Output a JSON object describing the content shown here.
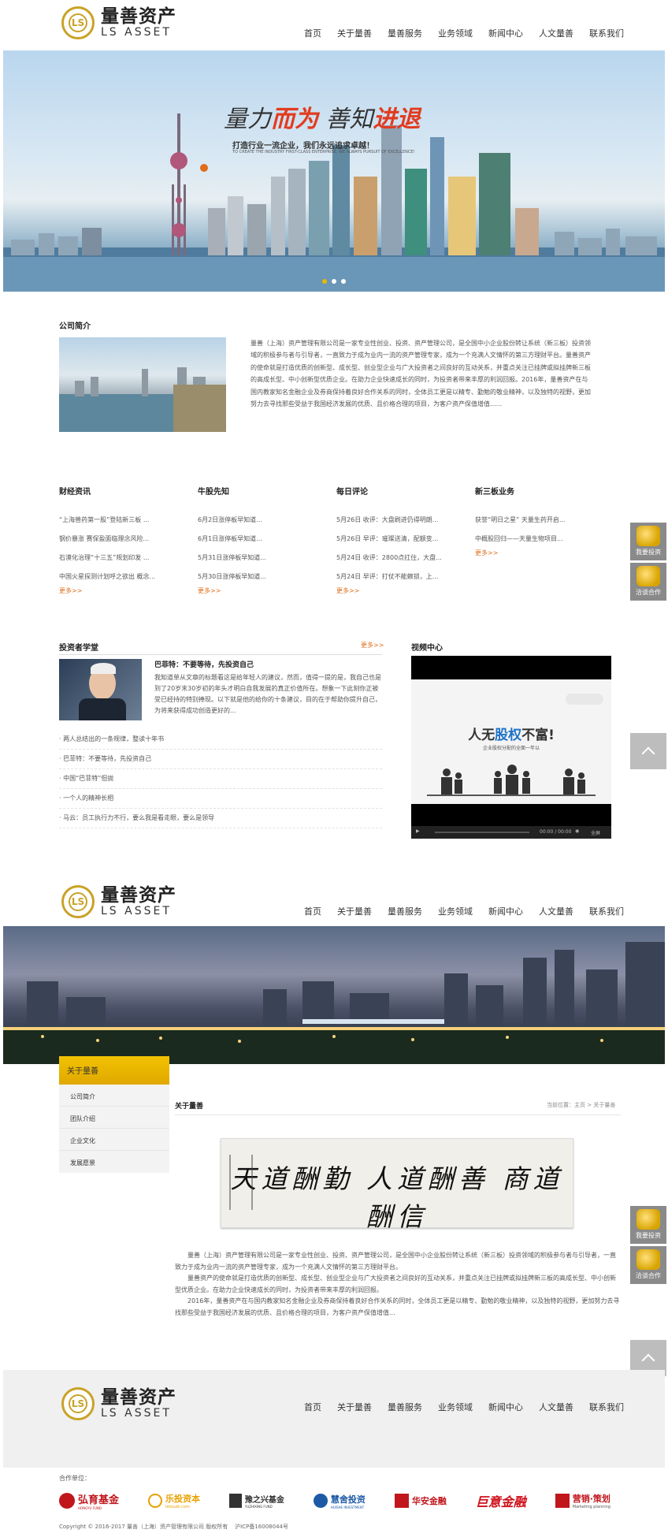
{
  "brand": {
    "name_cn": "量善资产",
    "name_en": "LS ASSET",
    "mark": "LS"
  },
  "nav": [
    "首页",
    "关于量善",
    "量善服务",
    "业务领域",
    "新闻中心",
    "人文量善",
    "联系我们"
  ],
  "banner1": {
    "slogan_part1": "量力",
    "slogan_part2": "而为",
    "slogan_part3": " 善知",
    "slogan_part4": "进退",
    "subtitle_cn": "打造行业一流企业，我们永远追求卓越！",
    "subtitle_en": "TO CREATE THE INDUSTRY FIRST-CLASS ENTERPRISE, WE ALWAYS PURSUIT OF EXCELLENCE!"
  },
  "intro": {
    "title": "公司简介",
    "text": "量善（上海）资产管理有限公司是一家专业性创业、投资、资产管理公司，是全国中小企业股份转让系统（新三板）投资领域的积极参与者与引导者，一直致力于成为业内一流的资产管理专家，成为一个充满人文情怀的第三方理财平台。量善资产的使命就是打造优质的创新型、成长型、创业型企业与广大投资者之间良好的互动关系，并重点关注已挂牌或拟挂牌新三板的高成长型、中小创新型优质企业。在助力企业快速成长的同时，为投资者带来丰厚的利润回报。2016年，量善资产在与国内教家知名金融企业及券商保持着良好合作关系的同时，全体员工更是以精专、勤勉的敬业精神，以及独特的视野，更加努力去寻找那些受益于我国经济发展的优质、且价格合理的项目，为客户资产保值增值......"
  },
  "news_columns": [
    {
      "title": "财经资讯",
      "items": [
        "“上海兽药第一股”登陆新三板 ...",
        "钢价暴涨 赛保盈面临理念风险...",
        "石漠化治理“十三五”规划印发 ...",
        "中国火星探测计划呼之欲出 概念..."
      ],
      "more": "更多>>"
    },
    {
      "title": "牛股先知",
      "items": [
        "6月2日涨停板早知道...",
        "6月1日涨停板早知道...",
        "5月31日涨停板早知道...",
        "5月30日涨停板早知道..."
      ],
      "more": "更多>>"
    },
    {
      "title": "每日评论",
      "items": [
        "5月26日 收评：大盘刷进仍得明朗...",
        "5月26日 早评：璀璨送清，配额变...",
        "5月24日 收评：2800点扛住，大盘...",
        "5月24日 早评：打仗不能赖锁，上..."
      ],
      "more": "更多>>"
    },
    {
      "title": "新三板业务",
      "items": [
        "获誉“明日之星” 天量生药开启...",
        "中概股回归——天量生物项目...",
        "",
        ""
      ],
      "more": "更多>>"
    }
  ],
  "school": {
    "title": "投资者学堂",
    "more": "更多>>",
    "feature_title": "巴菲特：不要等待，先投资自己",
    "feature_text": "我知道单从文章的标题看这是给年轻人的建议，然而，值得一提的是，我自己也是到了20岁末30岁初的年头才明白自我发展的真正价值所在。想象一下此刻你正被受已经持的特别捧现。以下就是他的给你的十条建议，目的在于帮助你提升自己，为将来获得成功创造更好的...",
    "items": [
      "两人总结出的一条规律，整读十年书",
      "巴菲特：不要等待，先投资自己",
      "中国“巴菲特”但拢",
      "一个人的精神长相",
      "马云：员工执行力不行，要么我是看走眼，要么是领导"
    ]
  },
  "video": {
    "title": "视频中心",
    "headline_pre": "人无",
    "headline_key": "股权",
    "headline_post": "不富!",
    "caption": "企业股权分配的全面一年以",
    "time": "00:00 / 00:00",
    "fullscreen": "全屏"
  },
  "side": {
    "invest": "我要投资",
    "cooperate": "洽谈合作"
  },
  "about": {
    "menu_title": "关于量善",
    "menu": [
      "公司简介",
      "团队介绍",
      "企业文化",
      "发展愿景"
    ],
    "heading": "关于量善",
    "breadcrumb": "当前位置：主页 > 关于量善",
    "calligraphy": "天道酬勤 人道酬善 商道酬信",
    "para1": "量善（上海）资产管理有限公司是一家专业性创业、投资、资产管理公司，是全国中小企业股份转让系统（新三板）投资领域的积极参与者与引导者，一直致力于成为业内一流的资产管理专家，成为一个充满人文情怀的第三方理财平台。",
    "para2": "量善资产的使命就是打造优质的创新型、成长型、创业型企业与广大投资者之间良好的互动关系，并重点关注已挂牌或拟挂牌新三板的高成长型、中小创新型优质企业。在助力企业快速成长的同时，为投资者带来丰厚的利润回报。",
    "para3": "2016年，量善资产在与国内教家知名金融企业及券商保持着良好合作关系的同时，全体员工更是以精专、勤勉的敬业精神，以及独特的视野，更加努力去寻找那些受益于我国经济发展的优质、且价格合理的项目，为客户资产保值增值..."
  },
  "footer": {
    "partners_label": "合作单位：",
    "partners": [
      "弘育基金",
      "乐投资本",
      "豫之兴基金",
      "慧舍投资",
      "华安金融",
      "巨意金融",
      "营销·策划"
    ],
    "partner_subs": [
      "HONGYU FUND",
      "letouzb.com",
      "YUZHIXING FUND",
      "HUISHE INVESTMENT",
      "",
      "",
      "Marketing planning"
    ],
    "copyright": "Copyright © 2016-2017 量善（上海）资产管理有限公司 版权所有",
    "icp": "沪ICP备16008044号"
  },
  "colors": {
    "accent": "#e06d1b",
    "gold": "#c9a227",
    "menu_gold": "#e8b800"
  }
}
